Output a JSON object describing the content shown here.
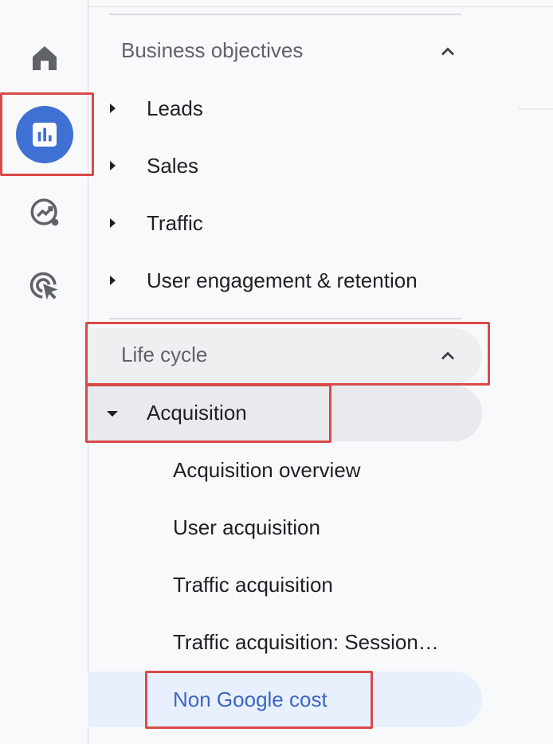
{
  "rail": {
    "items": [
      {
        "name": "home",
        "icon": "home-icon"
      },
      {
        "name": "reports",
        "icon": "bar-chart-icon",
        "active": true
      },
      {
        "name": "explore",
        "icon": "explore-trend-icon"
      },
      {
        "name": "advertising",
        "icon": "cursor-target-icon"
      }
    ]
  },
  "sections": {
    "business": {
      "title": "Business objectives",
      "items": [
        "Leads",
        "Sales",
        "Traffic",
        "User engagement & retention"
      ]
    },
    "lifecycle": {
      "title": "Life cycle",
      "acquisition": {
        "label": "Acquisition",
        "children": [
          "Acquisition overview",
          "User acquisition",
          "Traffic acquisition",
          "Traffic acquisition: Session…",
          "Non Google cost"
        ]
      }
    }
  },
  "colors": {
    "accent": "#3f70d3",
    "highlight_border": "#d94a4a",
    "selected_bg": "#e8f0fe",
    "selected_text": "#3c64c2",
    "hover_bg": "#e8eaed"
  }
}
